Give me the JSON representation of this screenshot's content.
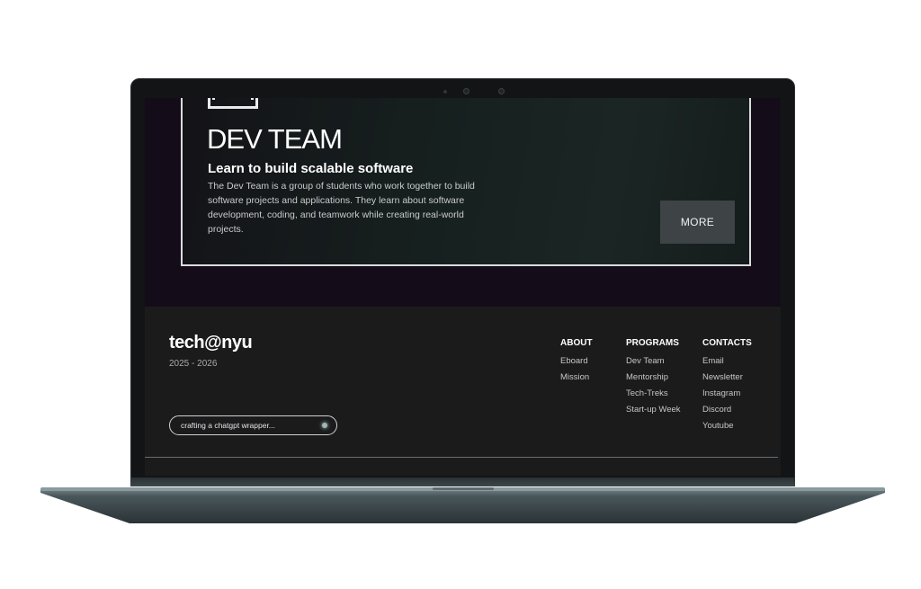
{
  "program": {
    "title": "DEV TEAM",
    "subtitle": "Learn to build scalable software",
    "description": "The Dev Team is a group of students who work together to build software projects and applications. They learn about software development, coding, and teamwork while creating real-world projects.",
    "more_label": "MORE"
  },
  "footer": {
    "brand": "tech@nyu",
    "years": "2025 - 2026",
    "status_text": "crafting a chatgpt wrapper...",
    "columns": [
      {
        "heading": "ABOUT",
        "links": [
          "Eboard",
          "Mission"
        ]
      },
      {
        "heading": "PROGRAMS",
        "links": [
          "Dev Team",
          "Mentorship",
          "Tech-Treks",
          "Start-up Week"
        ]
      },
      {
        "heading": "CONTACTS",
        "links": [
          "Email",
          "Newsletter",
          "Instagram",
          "Discord",
          "Youtube"
        ]
      }
    ]
  },
  "colors": {
    "screen_bg": "#140d19",
    "footer_bg": "#1b1b1c",
    "button_bg": "#3e4446",
    "laptop_body": "#3a4649"
  },
  "icons": {
    "card_icon": "monitor-stand-icon",
    "status_dot": "status-dot-icon"
  }
}
